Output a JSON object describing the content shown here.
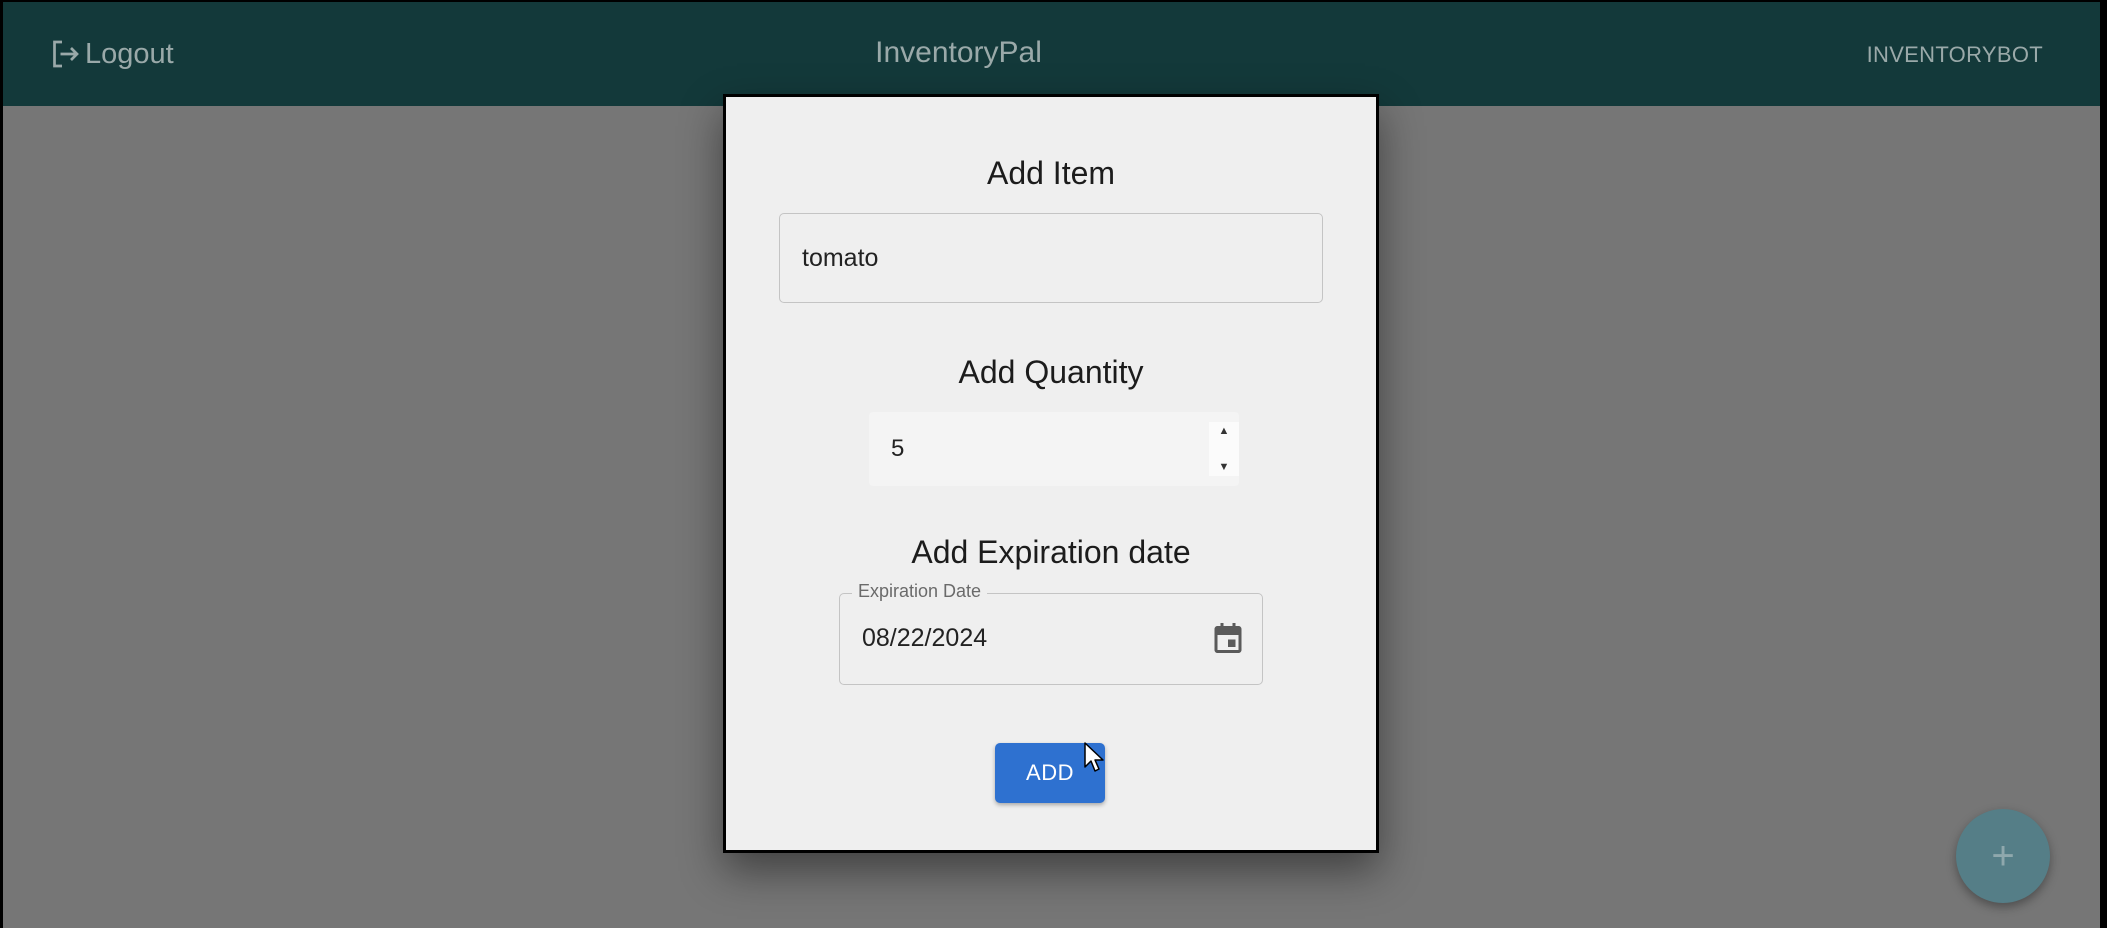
{
  "header": {
    "logout_label": "Logout",
    "app_title": "InventoryPal",
    "user_label": "INVENTORYBOT"
  },
  "dialog": {
    "item_title": "Add Item",
    "item_value": "tomato",
    "quantity_title": "Add Quantity",
    "quantity_value": "5",
    "expiration_title": "Add Expiration date",
    "expiration_legend": "Expiration Date",
    "expiration_value": "08/22/2024",
    "add_label": "ADD"
  },
  "fab": {
    "symbol": "+"
  },
  "icons": {
    "logout": "logout-icon",
    "calendar": "calendar-icon",
    "spinner_up": "▲",
    "spinner_down": "▼"
  },
  "colors": {
    "appbar": "#13393a",
    "backdrop": "#767676",
    "dialog": "#efefef",
    "primary_button": "#2e71d0",
    "fab": "#557e87"
  }
}
